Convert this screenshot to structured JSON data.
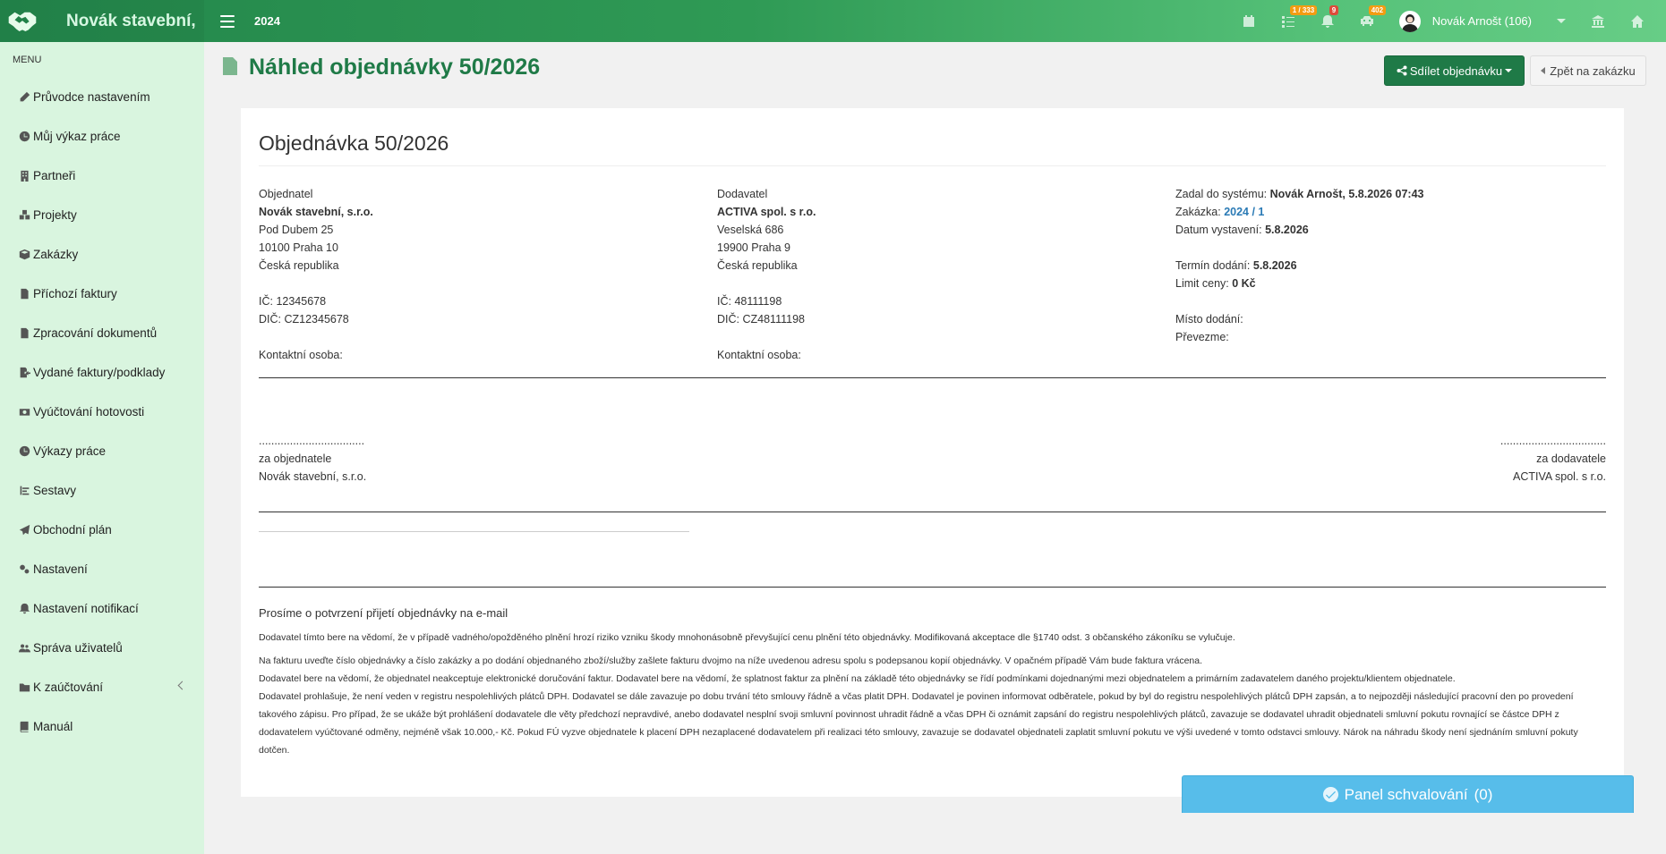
{
  "topbar": {
    "brand": "Novák stavební,",
    "year": "2024",
    "tasks_badge": "1 / 333",
    "notifications_badge": "9",
    "cars_badge": "402",
    "user_name": "Novák Arnošt (106)"
  },
  "sidebar": {
    "header": "MENU",
    "items": [
      {
        "label": "Průvodce nastavením",
        "icon": "pencil-icon"
      },
      {
        "label": "Můj výkaz práce",
        "icon": "clock-icon"
      },
      {
        "label": "Partneři",
        "icon": "building-icon"
      },
      {
        "label": "Projekty",
        "icon": "cubes-icon"
      },
      {
        "label": "Zakázky",
        "icon": "cube-icon"
      },
      {
        "label": "Příchozí faktury",
        "icon": "document-icon"
      },
      {
        "label": "Zpracování dokumentů",
        "icon": "document-icon"
      },
      {
        "label": "Vydané faktury/podklady",
        "icon": "export-document-icon"
      },
      {
        "label": "Vyúčtování hotovosti",
        "icon": "money-icon"
      },
      {
        "label": "Výkazy práce",
        "icon": "clock-icon"
      },
      {
        "label": "Sestavy",
        "icon": "list-icon"
      },
      {
        "label": "Obchodní plán",
        "icon": "paper-plane-icon"
      },
      {
        "label": "Nastavení",
        "icon": "gears-icon"
      },
      {
        "label": "Nastavení notifikací",
        "icon": "bell-icon"
      },
      {
        "label": "Správa uživatelů",
        "icon": "users-icon"
      },
      {
        "label": "K zaúčtování",
        "icon": "folder-icon"
      },
      {
        "label": "Manuál",
        "icon": "book-icon"
      }
    ]
  },
  "page": {
    "title": "Náhled objednávky 50/2026",
    "share_button": "Sdílet objednávku",
    "back_button": "Zpět na zakázku"
  },
  "order": {
    "title": "Objednávka 50/2026",
    "orderer": {
      "heading": "Objednatel",
      "name": "Novák stavební, s.r.o.",
      "street": "Pod Dubem 25",
      "city": "10100 Praha 10",
      "country": "Česká republika",
      "ic": "IČ: 12345678",
      "dic": "DIČ: CZ12345678",
      "contact": "Kontaktní osoba:"
    },
    "supplier": {
      "heading": "Dodavatel",
      "name": "ACTIVA spol. s r.o.",
      "street": "Veselská 686",
      "city": "19900 Praha 9",
      "country": "Česká republika",
      "ic": "IČ: 48111198",
      "dic": "DIČ: CZ48111198",
      "contact": "Kontaktní osoba:"
    },
    "meta": {
      "entered_label": "Zadal do systému:",
      "entered_value": "Novák Arnošt, 5.8.2026 07:43",
      "job_label": "Zakázka:",
      "job_value": "2024 / 1",
      "issue_label": "Datum vystavení:",
      "issue_value": "5.8.2026",
      "delivery_label": "Termín dodání:",
      "delivery_value": "5.8.2026",
      "price_label": "Limit ceny:",
      "price_value": "0 Kč",
      "place_label": "Místo dodání:",
      "pickup_label": "Převezme:"
    },
    "signature": {
      "dots": "..................................",
      "left_role": "za objednatele",
      "left_company": "Novák stavební, s.r.o.",
      "right_role": "za dodavatele",
      "right_company": "ACTIVA spol. s r.o."
    },
    "notes": {
      "heading": "Prosíme o potvrzení přijetí objednávky na e-mail",
      "p1": "Dodavatel tímto bere na vědomí, že v případě vadného/opožděného plnění hrozí riziko vzniku škody mnohonásobně převyšující cenu plnění této objednávky. Modifikovaná akceptace dle §1740 odst. 3 občanského zákoníku se vylučuje.",
      "p2": "Na fakturu uveďte číslo objednávky a číslo zakázky a po dodání objednaného zboží/služby zašlete fakturu dvojmo na níže uvedenou adresu spolu s podepsanou kopií objednávky. V opačném případě Vám bude faktura vrácena.",
      "p3": "Dodavatel bere na vědomí, že objednatel neakceptuje elektronické doručování faktur. Dodavatel bere na vědomí, že splatnost faktur za plnění na základě této objednávky se řídí podmínkami dojednanými mezi objednatelem a primárním zadavatelem daného projektu/klientem objednatele.",
      "p4": "Dodavatel prohlašuje, že není veden v registru nespolehlivých plátců DPH. Dodavatel se dále zavazuje po dobu trvání této smlouvy řádně a včas platit DPH. Dodavatel je povinen informovat odběratele, pokud by byl do registru nespolehlivých plátců DPH zapsán, a to nejpozději následující pracovní den po provedení takového zápisu. Pro případ, že se ukáže být prohlášení dodavatele dle věty předchozí nepravdivé, anebo dodavatel nesplní svoji smluvní povinnost uhradit řádně a včas DPH či oznámit zapsání do registru nespolehlivých plátců, zavazuje se dodavatel uhradit objednateli smluvní pokutu rovnající se částce DPH z dodavatelem vyúčtované odměny, nejméně však 10.000,- Kč. Pokud FÚ vyzve objednatele k placení DPH nezaplacené dodavatelem při realizaci této smlouvy, zavazuje se dodavatel objednateli zaplatit smluvní pokutu ve výši uvedené v tomto odstavci smlouvy. Nárok na náhradu škody není sjednáním smluvní pokuty dotčen."
    }
  },
  "approval_panel": {
    "label": "Panel schvalování",
    "count": "(0)"
  }
}
